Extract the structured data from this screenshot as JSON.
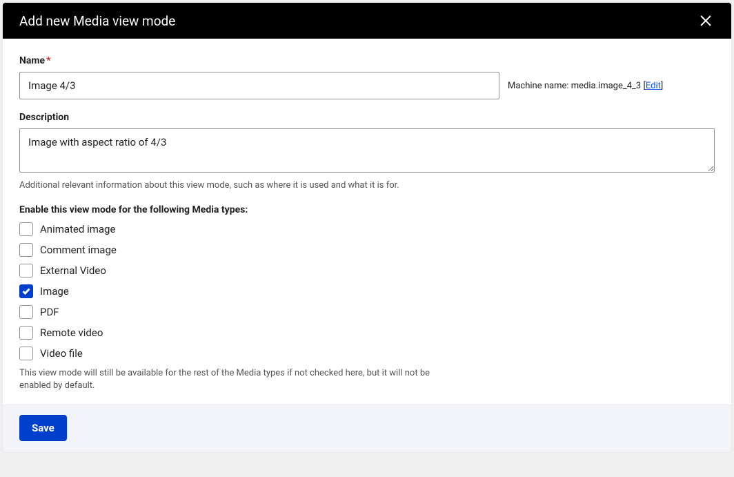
{
  "dialog": {
    "title": "Add new Media view mode",
    "close": "Close"
  },
  "form": {
    "name_label": "Name",
    "name_value": "Image 4/3",
    "machine_name_label": "Machine name: ",
    "machine_name_value": "media.image_4_3",
    "machine_bracket_open": " [",
    "machine_edit": "Edit",
    "machine_bracket_close": "]",
    "description_label": "Description",
    "description_value": "Image with aspect ratio of 4/3",
    "description_helper": "Additional relevant information about this view mode, such as where it is used and what it is for.",
    "types_label": "Enable this view mode for the following Media types:",
    "types": [
      {
        "label": "Animated image",
        "checked": false
      },
      {
        "label": "Comment image",
        "checked": false
      },
      {
        "label": "External Video",
        "checked": false
      },
      {
        "label": "Image",
        "checked": true
      },
      {
        "label": "PDF",
        "checked": false
      },
      {
        "label": "Remote video",
        "checked": false
      },
      {
        "label": "Video file",
        "checked": false
      }
    ],
    "types_helper": "This view mode will still be available for the rest of the Media types if not checked here, but it will not be enabled by default.",
    "save": "Save"
  }
}
